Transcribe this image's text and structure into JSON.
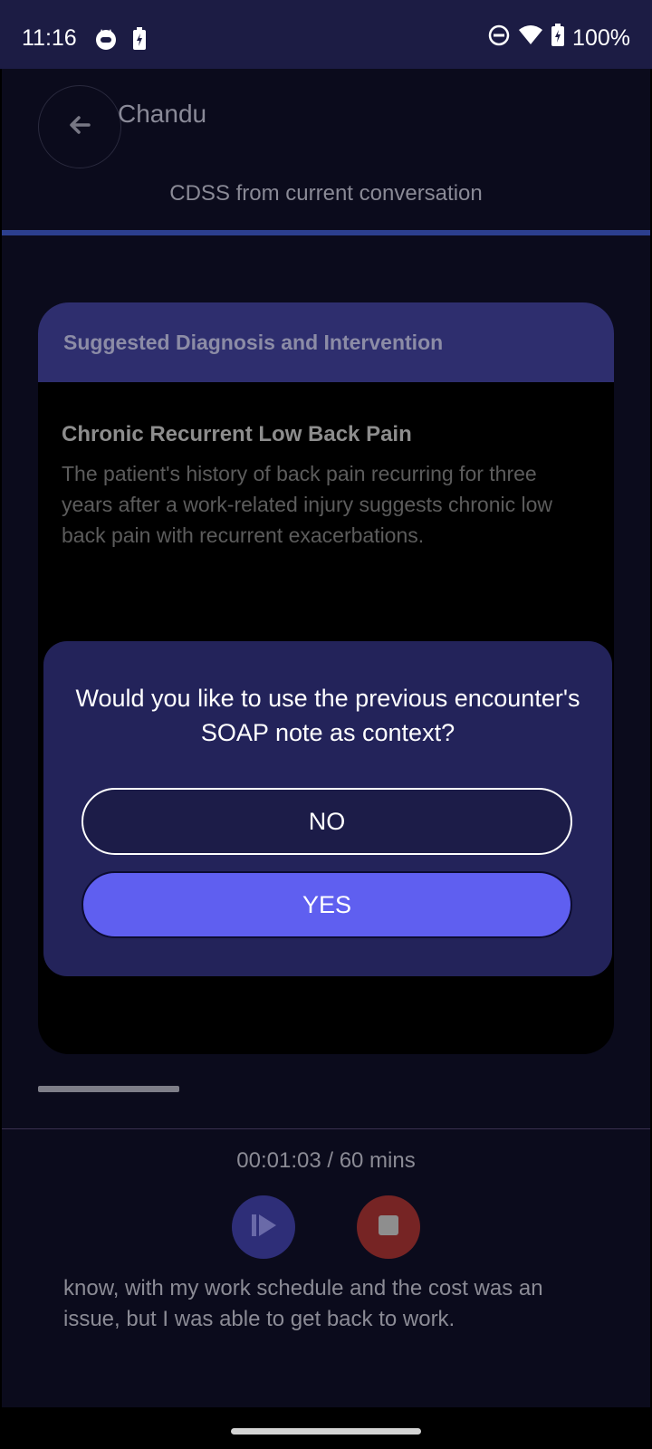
{
  "status_bar": {
    "time": "11:16",
    "battery": "100%",
    "icons": [
      "cat-notification-icon",
      "battery-saver-icon",
      "do-not-disturb-icon",
      "wifi-icon",
      "battery-charging-icon"
    ]
  },
  "app_bar": {
    "title": "Chandu",
    "back_icon": "arrow-left-icon"
  },
  "tab": {
    "label": "CDSS from current conversation"
  },
  "card": {
    "header": "Suggested Diagnosis and Intervention",
    "diagnosis_title": "Chronic Recurrent Low Back Pain",
    "diagnosis_description": "The patient's history of back pain recurring for three years after a work-related injury suggests chronic low back pain with recurrent exacerbations."
  },
  "dialog": {
    "message": "Would you like to use the previous encounter's SOAP note as context?",
    "no_label": "NO",
    "yes_label": "YES"
  },
  "recording": {
    "timer": "00:01:03 / 60 mins",
    "transcript": "know, with my work schedule and the cost was an issue, but I was able to get back to work."
  },
  "colors": {
    "status_bar_bg": "#1c1c44",
    "screen_bg": "#0b0b1c",
    "card_header_bg": "#2e2e6e",
    "dialog_bg": "#23235a",
    "accent": "#5f5ff0",
    "stop": "#762424",
    "tab_indicator": "#2c3f8e"
  }
}
